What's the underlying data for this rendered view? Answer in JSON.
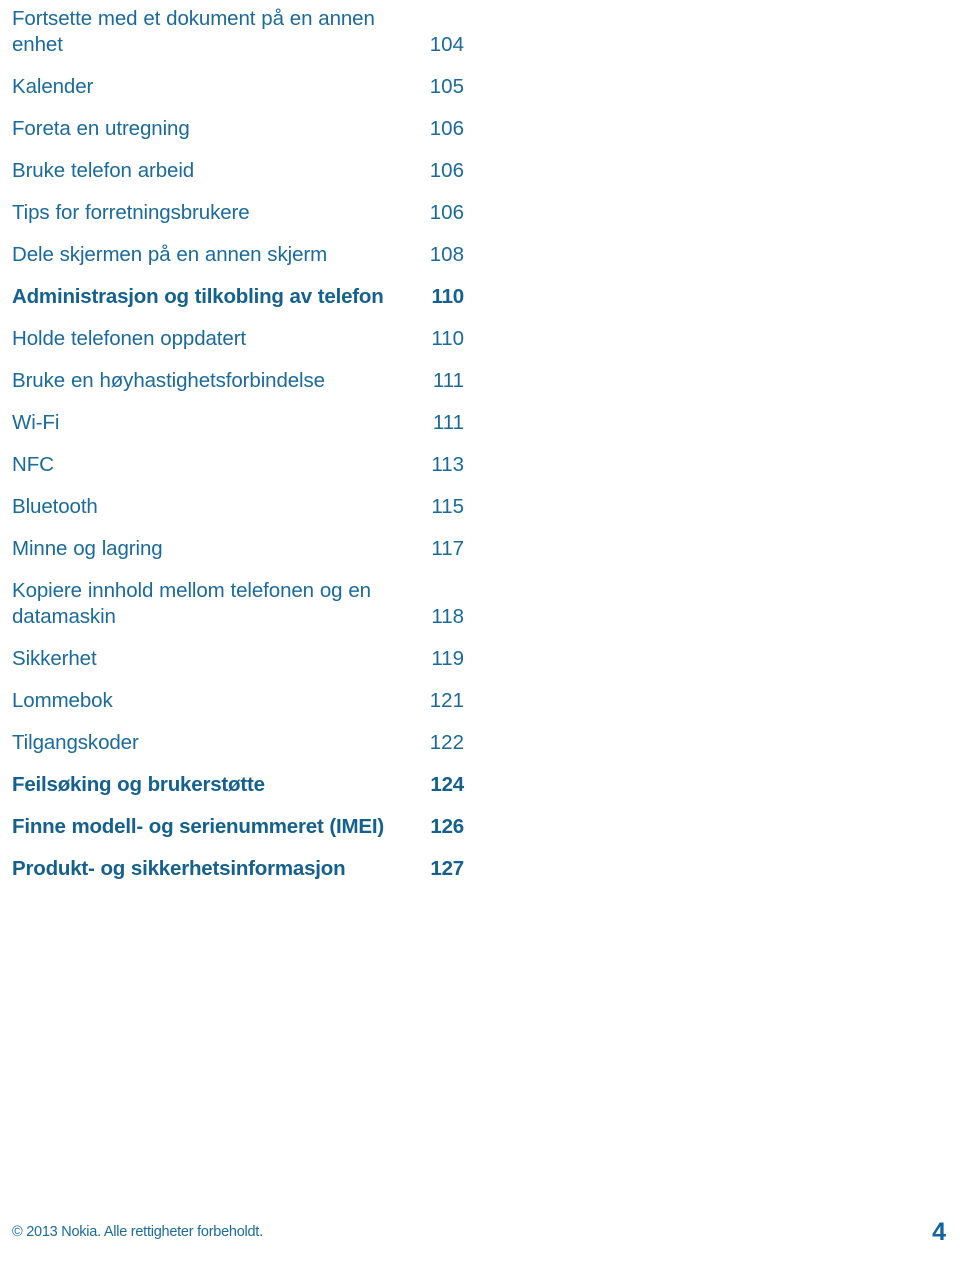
{
  "document": {
    "type": "table-of-contents",
    "language": "nb-NO"
  },
  "toc": {
    "entries": [
      {
        "title": "Fortsette med et dokument på en annen enhet",
        "page": "104",
        "bold": false,
        "wraps": true
      },
      {
        "title": "Kalender",
        "page": "105",
        "bold": false,
        "wraps": false
      },
      {
        "title": "Foreta en utregning",
        "page": "106",
        "bold": false,
        "wraps": false
      },
      {
        "title": "Bruke telefon arbeid",
        "page": "106",
        "bold": false,
        "wraps": false
      },
      {
        "title": "Tips for forretningsbrukere",
        "page": "106",
        "bold": false,
        "wraps": false
      },
      {
        "title": "Dele skjermen på en annen skjerm",
        "page": "108",
        "bold": false,
        "wraps": false
      },
      {
        "title": "Administrasjon og tilkobling av telefon",
        "page": "110",
        "bold": true,
        "wraps": false
      },
      {
        "title": "Holde telefonen oppdatert",
        "page": "110",
        "bold": false,
        "wraps": false
      },
      {
        "title": "Bruke en høyhastighetsforbindelse",
        "page": "111",
        "bold": false,
        "wraps": false
      },
      {
        "title": "Wi-Fi",
        "page": "111",
        "bold": false,
        "wraps": false
      },
      {
        "title": "NFC",
        "page": "113",
        "bold": false,
        "wraps": false
      },
      {
        "title": "Bluetooth",
        "page": "115",
        "bold": false,
        "wraps": false
      },
      {
        "title": "Minne og lagring",
        "page": "117",
        "bold": false,
        "wraps": false
      },
      {
        "title": "Kopiere innhold mellom telefonen og en datamaskin",
        "page": "118",
        "bold": false,
        "wraps": true
      },
      {
        "title": "Sikkerhet",
        "page": "119",
        "bold": false,
        "wraps": false
      },
      {
        "title": "Lommebok",
        "page": "121",
        "bold": false,
        "wraps": false
      },
      {
        "title": "Tilgangskoder",
        "page": "122",
        "bold": false,
        "wraps": false
      },
      {
        "title": "Feilsøking og brukerstøtte",
        "page": "124",
        "bold": true,
        "wraps": false
      },
      {
        "title": "Finne modell- og serienummeret (IMEI)",
        "page": "126",
        "bold": true,
        "wraps": false
      },
      {
        "title": "Produkt- og sikkerhetsinformasjon",
        "page": "127",
        "bold": true,
        "wraps": false
      }
    ]
  },
  "footer": {
    "copyright": "© 2013 Nokia. Alle rettigheter forbeholdt.",
    "page_number": "4"
  },
  "colors": {
    "text_regular": "#1a6a9c",
    "text_bold": "#14618f",
    "background": "#ffffff"
  }
}
